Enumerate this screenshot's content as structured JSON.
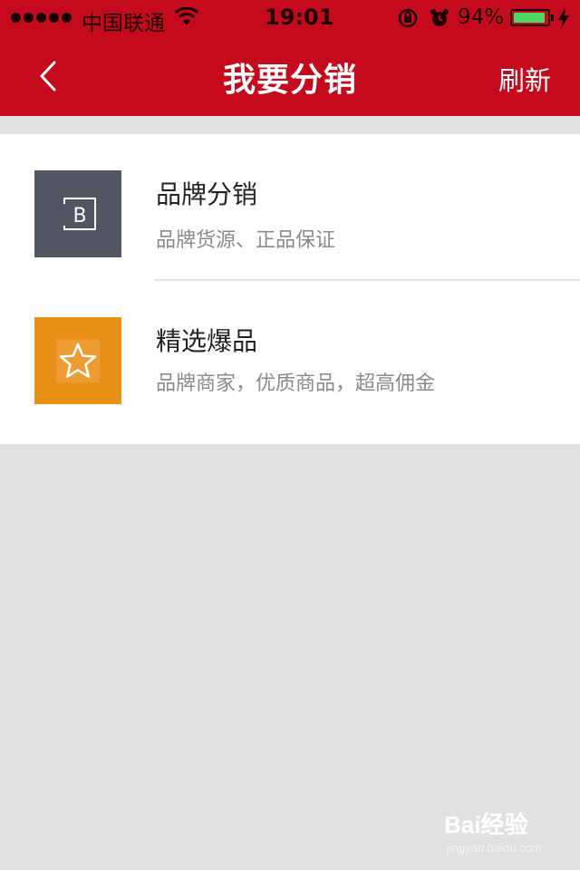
{
  "status_bar": {
    "carrier": "中国联通",
    "time": "19:01",
    "battery_percent": "94%",
    "battery_level": 0.94,
    "icons": [
      "signal-dots-icon",
      "wifi-icon",
      "rotation-lock-icon",
      "alarm-icon",
      "battery-icon",
      "charging-bolt-icon"
    ]
  },
  "nav": {
    "title": "我要分销",
    "refresh_label": "刷新",
    "back_icon": "chevron-left-icon"
  },
  "items": [
    {
      "title": "品牌分销",
      "subtitle": "品牌货源、正品保证",
      "icon": "brand-b-icon",
      "thumb_color": "#525660"
    },
    {
      "title": "精选爆品",
      "subtitle": "品牌商家，优质商品，超高佣金",
      "icon": "star-icon",
      "thumb_color": "#e89016"
    }
  ],
  "colors": {
    "header": "#c60a1e",
    "background": "#e1e1e1"
  },
  "watermark": {
    "main": "Bai经验",
    "sub": "jingyan.baidu.com"
  }
}
